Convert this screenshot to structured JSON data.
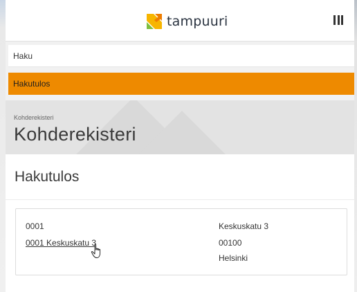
{
  "brand": {
    "logo_text": "tampuuri",
    "logo_colors": [
      "#f7b500",
      "#ee7d00",
      "#7fbf3f",
      "#2a3340"
    ]
  },
  "header": {
    "menu_icon": "menu-icon"
  },
  "nav": {
    "items": [
      {
        "label": "Haku",
        "active": false
      },
      {
        "label": "Hakutulos",
        "active": true
      }
    ],
    "active_color": "#ee8a00"
  },
  "page": {
    "breadcrumb": "Kohderekisteri",
    "title": "Kohderekisteri"
  },
  "results": {
    "section_title": "Hakutulos",
    "items": [
      {
        "number": "0001",
        "link_text": "0001 Keskuskatu 3",
        "street": "Keskuskatu 3",
        "postal_code": "00100",
        "city": "Helsinki"
      }
    ]
  },
  "cursor": {
    "icon": "hand-pointer-icon"
  }
}
